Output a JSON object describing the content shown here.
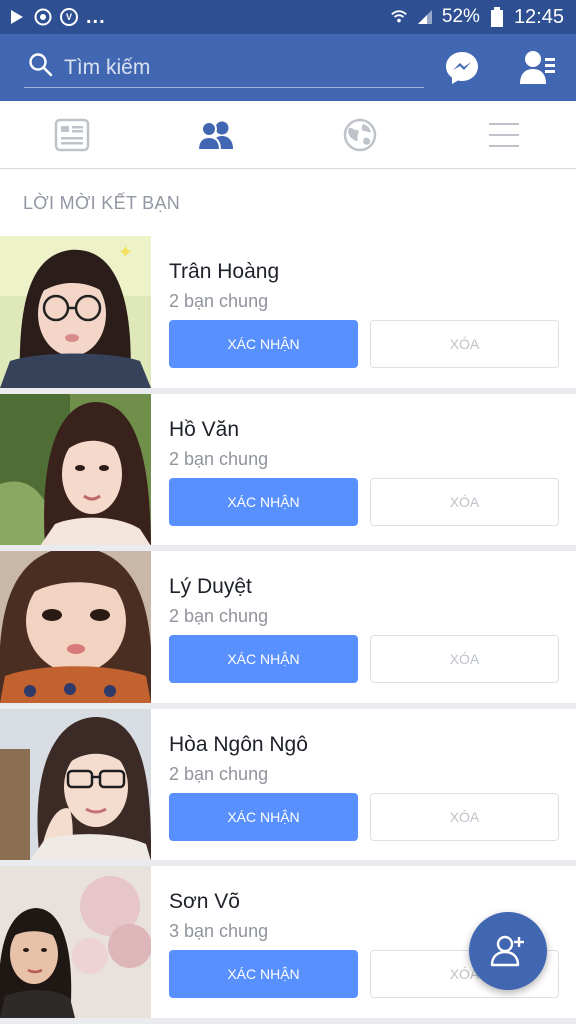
{
  "status_bar": {
    "battery": "52%",
    "time": "12:45"
  },
  "search": {
    "placeholder": "Tìm kiếm"
  },
  "section": {
    "title": "LỜI MỜI KẾT BẠN"
  },
  "requests": [
    {
      "name": "Trân Hoàng",
      "mutual": "2 bạn chung",
      "confirm_label": "XÁC NHẬN",
      "delete_label": "XÓA"
    },
    {
      "name": "Hồ Văn",
      "mutual": "2 bạn chung",
      "confirm_label": "XÁC NHẬN",
      "delete_label": "XÓA"
    },
    {
      "name": "Lý Duyệt",
      "mutual": "2 bạn chung",
      "confirm_label": "XÁC NHẬN",
      "delete_label": "XÓA"
    },
    {
      "name": "Hòa Ngôn Ngô",
      "mutual": "2 bạn chung",
      "confirm_label": "XÁC NHẬN",
      "delete_label": "XÓA"
    },
    {
      "name": "Sơn Võ",
      "mutual": "3 bạn chung",
      "confirm_label": "XÁC NHẬN",
      "delete_label": "XÓA"
    }
  ],
  "colors": {
    "header": "#4267b2",
    "status_bar": "#2f4f93",
    "confirm": "#5890ff",
    "active_tab": "#4267b2"
  }
}
